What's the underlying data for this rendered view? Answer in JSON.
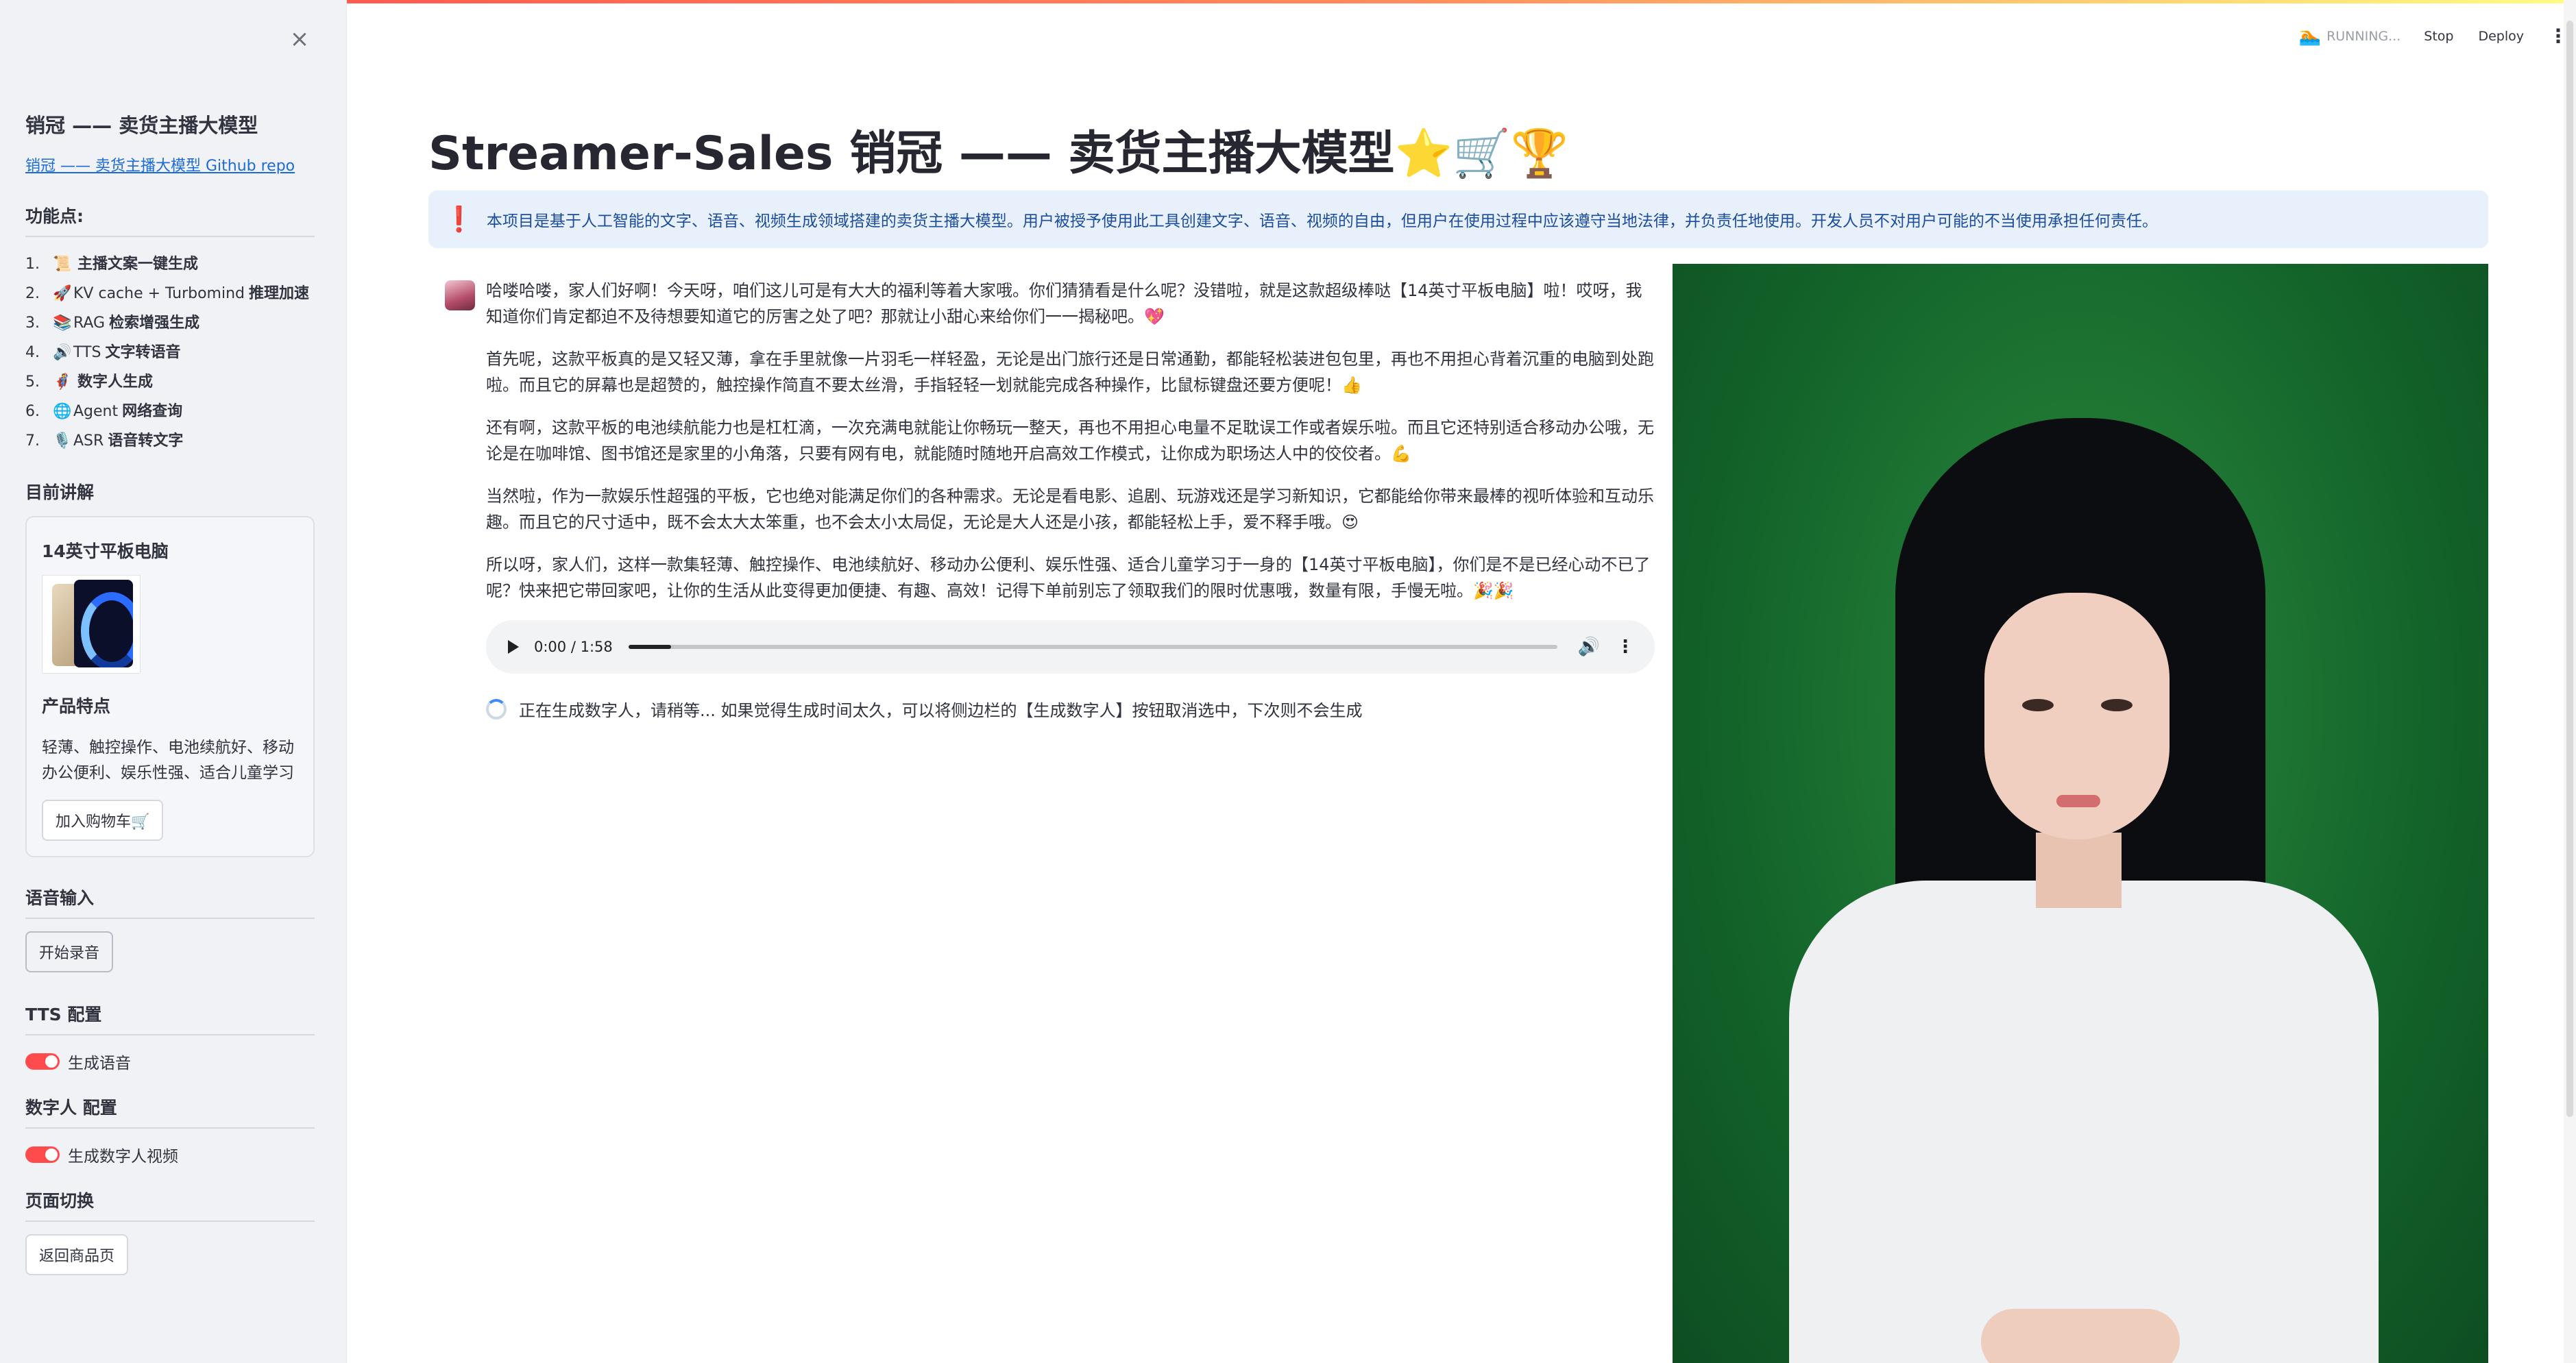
{
  "sidebar": {
    "close_icon": "×",
    "title": "销冠 —— 卖货主播大模型",
    "repo_link": "销冠 —— 卖货主播大模型 Github repo",
    "features_heading": "功能点:",
    "features": [
      {
        "num": "1.",
        "icon": "📜",
        "pre": "",
        "bold": "主播文案一键生成"
      },
      {
        "num": "2.",
        "icon": "🚀",
        "pre": "KV cache + Turbomind",
        "bold": "推理加速"
      },
      {
        "num": "3.",
        "icon": "📚",
        "pre": "RAG",
        "bold": "检索增强生成"
      },
      {
        "num": "4.",
        "icon": "🔊",
        "pre": "TTS",
        "bold": "文字转语音"
      },
      {
        "num": "5.",
        "icon": "🦸",
        "pre": "",
        "bold": "数字人生成"
      },
      {
        "num": "6.",
        "icon": "🌐",
        "pre": "Agent",
        "bold": "网络查询"
      },
      {
        "num": "7.",
        "icon": "🎙️",
        "pre": "ASR",
        "bold": "语音转文字"
      }
    ],
    "current_heading": "目前讲解",
    "product": {
      "name": "14英寸平板电脑",
      "features_title": "产品特点",
      "features_text": "轻薄、触控操作、电池续航好、移动办公便利、娱乐性强、适合儿童学习",
      "cart_button": "加入购物车🛒"
    },
    "voice_heading": "语音输入",
    "record_button": "开始录音",
    "tts_heading": "TTS 配置",
    "tts_toggle": "生成语音",
    "digital_heading": "数字人 配置",
    "digital_toggle": "生成数字人视频",
    "page_heading": "页面切换",
    "back_button": "返回商品页"
  },
  "header": {
    "running_icon": "🏊",
    "running": "RUNNING...",
    "stop": "Stop",
    "deploy": "Deploy",
    "menu_icon": "⋮"
  },
  "main": {
    "title": "Streamer-Sales 销冠 —— 卖货主播大模型⭐🛒🏆",
    "alert_icon": "❗",
    "alert": "本项目是基于人工智能的文字、语音、视频生成领域搭建的卖货主播大模型。用户被授予使用此工具创建文字、语音、视频的自由，但用户在使用过程中应该遵守当地法律，并负责任地使用。开发人员不对用户可能的不当使用承担任何责任。",
    "paragraphs": [
      "哈喽哈喽，家人们好啊！今天呀，咱们这儿可是有大大的福利等着大家哦。你们猜猜看是什么呢？没错啦，就是这款超级棒哒【14英寸平板电脑】啦！哎呀，我知道你们肯定都迫不及待想要知道它的厉害之处了吧？那就让小甜心来给你们一一揭秘吧。💖",
      "首先呢，这款平板真的是又轻又薄，拿在手里就像一片羽毛一样轻盈，无论是出门旅行还是日常通勤，都能轻松装进包包里，再也不用担心背着沉重的电脑到处跑啦。而且它的屏幕也是超赞的，触控操作简直不要太丝滑，手指轻轻一划就能完成各种操作，比鼠标键盘还要方便呢！👍",
      "还有啊，这款平板的电池续航能力也是杠杠滴，一次充满电就能让你畅玩一整天，再也不用担心电量不足耽误工作或者娱乐啦。而且它还特别适合移动办公哦，无论是在咖啡馆、图书馆还是家里的小角落，只要有网有电，就能随时随地开启高效工作模式，让你成为职场达人中的佼佼者。💪",
      "当然啦，作为一款娱乐性超强的平板，它也绝对能满足你们的各种需求。无论是看电影、追剧、玩游戏还是学习新知识，它都能给你带来最棒的视听体验和互动乐趣。而且它的尺寸适中，既不会太大太笨重，也不会太小太局促，无论是大人还是小孩，都能轻松上手，爱不释手哦。😍",
      "所以呀，家人们，这样一款集轻薄、触控操作、电池续航好、移动办公便利、娱乐性强、适合儿童学习于一身的【14英寸平板电脑】，你们是不是已经心动不已了呢？快来把它带回家吧，让你的生活从此变得更加便捷、有趣、高效！记得下单前别忘了领取我们的限时优惠哦，数量有限，手慢无啦。🎉🎉"
    ],
    "audio": {
      "time": "0:00 / 1:58",
      "progress": 0.046,
      "play_icon": "play-icon",
      "volume_icon": "🔊",
      "more_icon": "⋮"
    },
    "status": "正在生成数字人，请稍等... 如果觉得生成时间太久，可以将侧边栏的【生成数字人】按钮取消选中，下次则不会生成"
  }
}
